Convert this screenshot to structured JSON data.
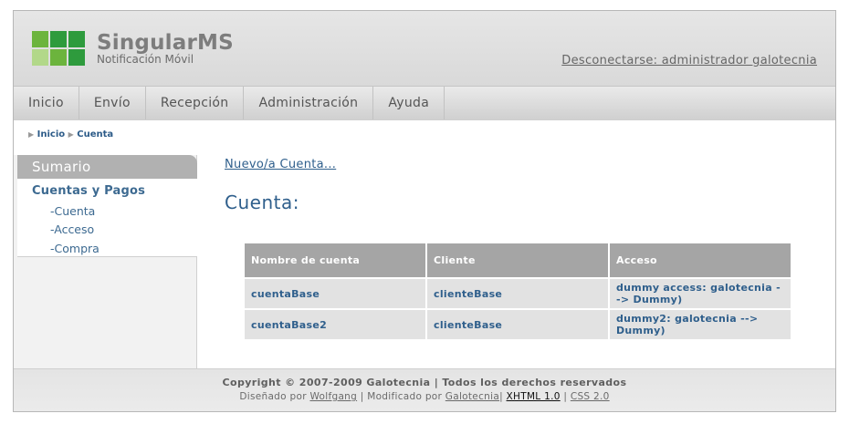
{
  "header": {
    "title": "SingularMS",
    "subtitle": "Notificación Móvil",
    "logout_link": "Desconectarse: administrador galotecnia"
  },
  "nav": {
    "items": [
      "Inicio",
      "Envío",
      "Recepción",
      "Administración",
      "Ayuda"
    ]
  },
  "breadcrumb": {
    "items": [
      "Inicio",
      "Cuenta"
    ]
  },
  "sidebar": {
    "heading": "Sumario",
    "section": "Cuentas y Pagos",
    "links": [
      "-Cuenta",
      "-Acceso",
      "-Compra"
    ]
  },
  "main": {
    "new_link": "Nuevo/a Cuenta...",
    "title": "Cuenta:",
    "table": {
      "headers": [
        "Nombre de cuenta",
        "Cliente",
        "Acceso"
      ],
      "rows": [
        [
          "cuentaBase",
          "clienteBase",
          "dummy access: galotecnia --> Dummy)"
        ],
        [
          "cuentaBase2",
          "clienteBase",
          "dummy2: galotecnia --> Dummy)"
        ]
      ]
    }
  },
  "footer": {
    "copyright": "Copyright © 2007-2009 Galotecnia | Todos los derechos reservados",
    "designed_by_prefix": "Diseñado por",
    "designer": "Wolfgang",
    "separator1": "|",
    "modified_by_prefix": "Modificado por",
    "modifier": "Galotecnia",
    "separator2": "|",
    "xhtml": "XHTML 1.0",
    "separator3": "|",
    "css": "CSS 2.0"
  },
  "colors": {
    "logo_green_dark": "#2e9b3d",
    "logo_green_mid": "#6cb43d",
    "logo_green_light": "#b2d889",
    "link_blue": "#2f5f8c"
  }
}
